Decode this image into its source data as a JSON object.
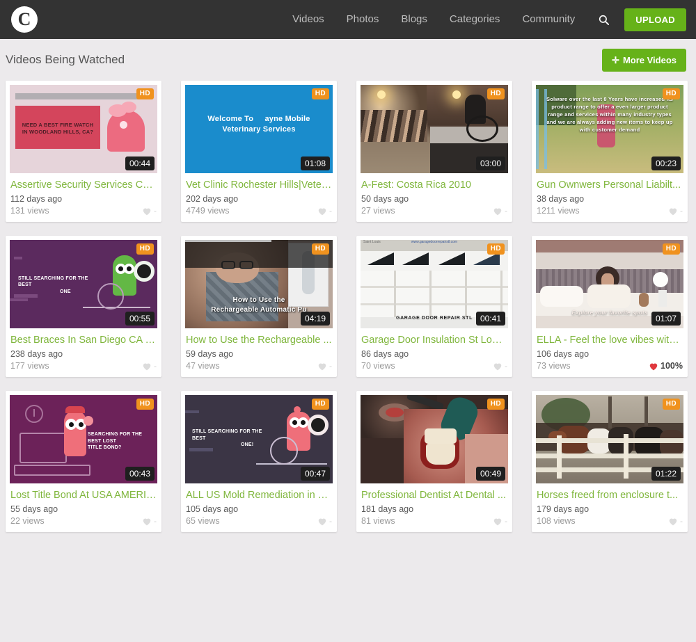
{
  "header": {
    "logo_icon": "circle-c-logo",
    "nav": [
      {
        "label": "Videos"
      },
      {
        "label": "Photos"
      },
      {
        "label": "Blogs"
      },
      {
        "label": "Categories"
      },
      {
        "label": "Community"
      }
    ],
    "search_icon": "search-icon",
    "upload_label": "UPLOAD",
    "bg_color": "#333333",
    "accent_color": "#66b219"
  },
  "titlebar": {
    "title": "Videos Being Watched",
    "more_plus": "✛",
    "more_label": "More Videos"
  },
  "badges": {
    "hd_label": "HD",
    "hd_color": "#f0921e"
  },
  "videos": [
    {
      "title": "Assertive Security Services Con...",
      "date": "112 days ago",
      "views": "131 views",
      "duration": "00:44",
      "hd": "HD",
      "rating": "-",
      "rating_liked": false,
      "thumb_text": "NEED A BEST FIRE WATCH IN WOODLAND HILLS, CA?",
      "thumb_style": "fire-watch"
    },
    {
      "title": "Vet Clinic Rochester Hills|Veter...",
      "date": "202 days ago",
      "views": "4749 views",
      "duration": "01:08",
      "hd": "HD",
      "rating": "-",
      "rating_liked": false,
      "thumb_text": "Welcome To   ayne Mobile Veterinary Services",
      "thumb_style": "vet-blue"
    },
    {
      "title": "A-Fest: Costa Rica 2010",
      "date": "50 days ago",
      "views": "27 views",
      "duration": "03:00",
      "hd": "HD",
      "rating": "-",
      "rating_liked": false,
      "thumb_text": "",
      "thumb_style": "afest-room"
    },
    {
      "title": "Gun Ownwers Personal Liabilt...",
      "date": "38 days ago",
      "views": "1211 views",
      "duration": "00:23",
      "hd": "HD",
      "rating": "-",
      "rating_liked": false,
      "thumb_text": "Solware over the last 8 Years have increased its product range to offer a even larger product range and services within many industry types and we are always adding new items to keep up with customer demand",
      "thumb_style": "gun-field"
    },
    {
      "title": "Best Braces In San Diego CA : C...",
      "date": "238 days ago",
      "views": "177 views",
      "duration": "00:55",
      "hd": "HD",
      "rating": "-",
      "rating_liked": false,
      "thumb_text": "STILL SEARCHING FOR THE BEST ONE",
      "thumb_style": "braces-purple"
    },
    {
      "title": "How to Use the Rechargeable ...",
      "date": "59 days ago",
      "views": "47 views",
      "duration": "04:19",
      "hd": "HD",
      "rating": "-",
      "rating_liked": false,
      "thumb_text": "How to Use the Rechargeable Automatic Pu",
      "thumb_style": "rechargeable-man"
    },
    {
      "title": "Garage Door Insulation St Loui...",
      "date": "86 days ago",
      "views": "70 views",
      "duration": "00:41",
      "hd": "HD",
      "rating": "-",
      "rating_liked": false,
      "thumb_text": "GARAGE DOOR REPAIR STL",
      "thumb_style": "garage-door"
    },
    {
      "title": "ELLA - Feel the love vibes with ...",
      "date": "106 days ago",
      "views": "73 views",
      "duration": "01:07",
      "hd": "HD",
      "rating": "100%",
      "rating_liked": true,
      "thumb_text": "Explore your favorite spots",
      "thumb_style": "ella-bed"
    },
    {
      "title": "Lost Title Bond At USA AMERIC...",
      "date": "55 days ago",
      "views": "22 views",
      "duration": "00:43",
      "hd": "HD",
      "rating": "-",
      "rating_liked": false,
      "thumb_text": "SEARCHING FOR THE BEST LOST TITLE BOND?",
      "thumb_style": "title-bond"
    },
    {
      "title": "ALL US Mold Remediation in B...",
      "date": "105 days ago",
      "views": "65 views",
      "duration": "00:47",
      "hd": "HD",
      "rating": "-",
      "rating_liked": false,
      "thumb_text": "STILL SEARCHING FOR THE BEST ONE!",
      "thumb_style": "mold-dark"
    },
    {
      "title": "Professional Dentist At Dental ...",
      "date": "181 days ago",
      "views": "81 views",
      "duration": "00:49",
      "hd": "HD",
      "rating": "-",
      "rating_liked": false,
      "thumb_text": "",
      "thumb_style": "dentist"
    },
    {
      "title": "Horses freed from enclosure t...",
      "date": "179 days ago",
      "views": "108 views",
      "duration": "01:22",
      "hd": "HD",
      "rating": "-",
      "rating_liked": false,
      "thumb_text": "",
      "thumb_style": "horses"
    }
  ]
}
